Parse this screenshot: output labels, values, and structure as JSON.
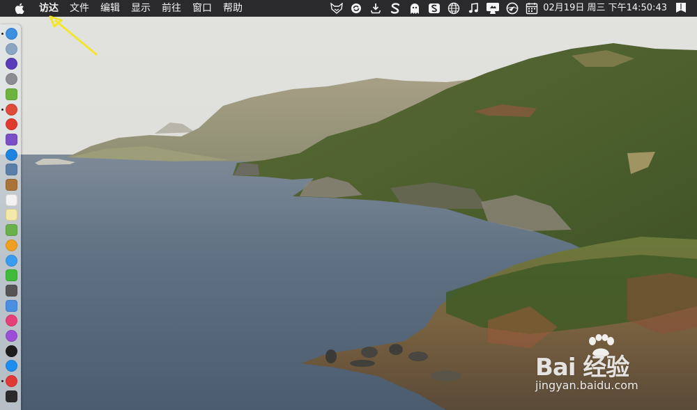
{
  "menubar": {
    "items": [
      {
        "label": "访达",
        "active": true
      },
      {
        "label": "文件"
      },
      {
        "label": "编辑"
      },
      {
        "label": "显示"
      },
      {
        "label": "前往"
      },
      {
        "label": "窗口"
      },
      {
        "label": "帮助"
      }
    ],
    "status_icons": [
      "fox-icon",
      "refresh-icon",
      "download-icon",
      "s-app-icon",
      "qq-ghost-icon",
      "sogou-icon",
      "globe-icon",
      "music-note-icon",
      "display-icon",
      "compass-icon",
      "calendar-icon"
    ],
    "clock": "02月19日 周三 下午14:50:43",
    "notification_icon": "notification-center-icon"
  },
  "dock": {
    "icons": [
      {
        "name": "finder-icon",
        "color": "#3d8fe0"
      },
      {
        "name": "launchpad-icon",
        "color": "#8aa6c2"
      },
      {
        "name": "siri-icon",
        "color": "#5a3bb8"
      },
      {
        "name": "rocket-icon",
        "color": "#8c8c92"
      },
      {
        "name": "android-icon",
        "color": "#6db33f"
      },
      {
        "name": "chrome-icon",
        "color": "#de4b3a"
      },
      {
        "name": "app-red-icon",
        "color": "#e03a2f"
      },
      {
        "name": "app-purple-icon",
        "color": "#7a4fc8"
      },
      {
        "name": "safari-icon",
        "color": "#1e84e0"
      },
      {
        "name": "preview-icon",
        "color": "#5a7fa8"
      },
      {
        "name": "notebook-icon",
        "color": "#a8743a"
      },
      {
        "name": "calendar-app-icon",
        "color": "#f2f2f2"
      },
      {
        "name": "notes-icon",
        "color": "#f4e9a8"
      },
      {
        "name": "maps-icon",
        "color": "#6ab04c"
      },
      {
        "name": "photos-icon",
        "color": "#f0a020"
      },
      {
        "name": "messages-bubble-icon",
        "color": "#3a9cf0"
      },
      {
        "name": "wechat-icon",
        "color": "#3fba3a"
      },
      {
        "name": "facetime-icon",
        "color": "#555555"
      },
      {
        "name": "preview-stand-icon",
        "color": "#4a8ee0"
      },
      {
        "name": "itunes-icon",
        "color": "#e5407a"
      },
      {
        "name": "podcasts-icon",
        "color": "#9a4fd6"
      },
      {
        "name": "tv-icon",
        "color": "#1d1d1d"
      },
      {
        "name": "app-store-icon",
        "color": "#1c8ef0"
      },
      {
        "name": "vivaldi-icon",
        "color": "#e13838"
      },
      {
        "name": "terminal-icon",
        "color": "#2b2b2b"
      }
    ]
  },
  "watermark": {
    "brand": "Bai 经验",
    "subtitle": "jingyan.baidu.com"
  },
  "colors": {
    "menubar": "#2a2a2c",
    "annotation_arrow": "#f3e62a"
  }
}
